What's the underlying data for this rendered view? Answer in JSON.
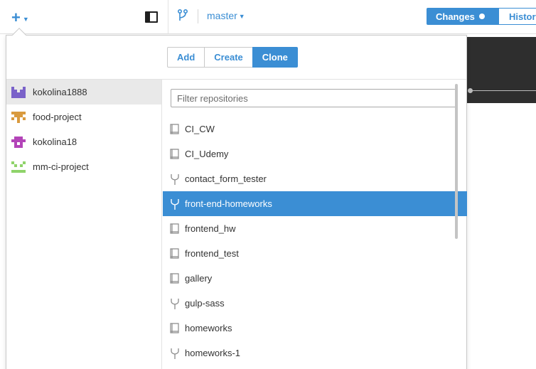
{
  "toolbar": {
    "add_menu_icon": "plus-icon",
    "branch_name": "master",
    "tabs": [
      {
        "label": "Changes",
        "active": true
      },
      {
        "label": "History",
        "active": false
      }
    ]
  },
  "popup": {
    "segments": [
      {
        "label": "Add",
        "active": false
      },
      {
        "label": "Create",
        "active": false
      },
      {
        "label": "Clone",
        "active": true
      }
    ],
    "accounts": [
      {
        "name": "kokolina1888",
        "selected": true,
        "avatar_color": "#7a62c9"
      },
      {
        "name": "food-project",
        "selected": false,
        "avatar_color": "#d99a3e"
      },
      {
        "name": "kokolina18",
        "selected": false,
        "avatar_color": "#b344b8"
      },
      {
        "name": "mm-ci-project",
        "selected": false,
        "avatar_color": "#8fd36a"
      }
    ],
    "filter": {
      "placeholder": "Filter repositories",
      "value": ""
    },
    "repositories": [
      {
        "name": "CI_CW",
        "type": "repo",
        "selected": false
      },
      {
        "name": "CI_Udemy",
        "type": "repo",
        "selected": false
      },
      {
        "name": "contact_form_tester",
        "type": "fork",
        "selected": false
      },
      {
        "name": "front-end-homeworks",
        "type": "fork",
        "selected": true
      },
      {
        "name": "frontend_hw",
        "type": "repo",
        "selected": false
      },
      {
        "name": "frontend_test",
        "type": "repo",
        "selected": false
      },
      {
        "name": "gallery",
        "type": "repo",
        "selected": false
      },
      {
        "name": "gulp-sass",
        "type": "fork",
        "selected": false
      },
      {
        "name": "homeworks",
        "type": "repo",
        "selected": false
      },
      {
        "name": "homeworks-1",
        "type": "fork",
        "selected": false
      }
    ]
  },
  "colors": {
    "accent": "#3b8ed4",
    "selection": "#3b8ed4",
    "dark_panel": "#2e2e2e"
  }
}
